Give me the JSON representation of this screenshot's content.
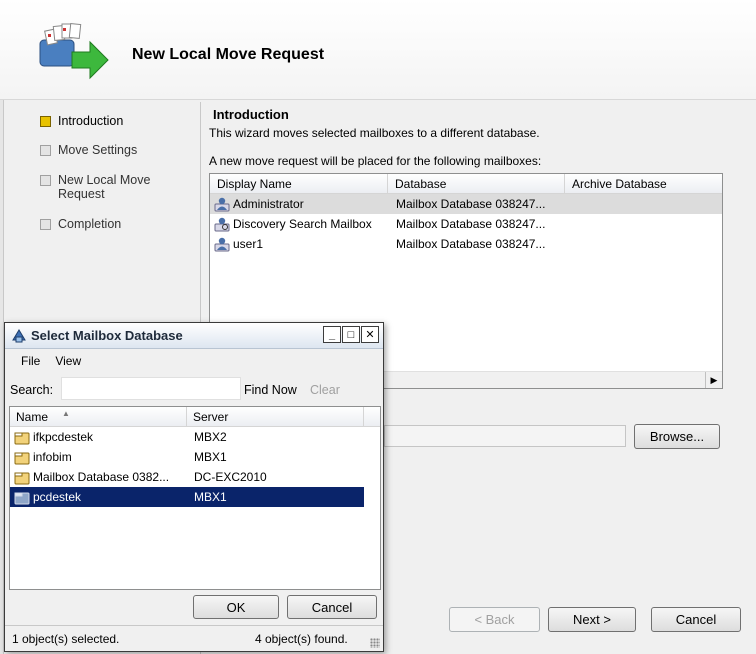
{
  "wizard": {
    "title": "New Local Move Request",
    "steps": [
      {
        "label": "Introduction",
        "active": true
      },
      {
        "label": "Move Settings",
        "active": false
      },
      {
        "label": "New Local Move Request",
        "active": false
      },
      {
        "label": "Completion",
        "active": false
      }
    ],
    "intro_title": "Introduction",
    "intro_desc": "This wizard moves selected mailboxes to a different database.",
    "list_caption": "A new move request will be placed for the following mailboxes:",
    "columns": [
      "Display Name",
      "Database",
      "Archive Database"
    ],
    "rows": [
      {
        "name": "Administrator",
        "database": "Mailbox Database 038247...",
        "archive": "",
        "selected": true
      },
      {
        "name": "Discovery Search Mailbox",
        "database": "Mailbox Database 038247...",
        "archive": "",
        "selected": false
      },
      {
        "name": "user1",
        "database": "Mailbox Database 038247...",
        "archive": "",
        "selected": false
      }
    ],
    "browse_label": "Browse...",
    "back_label": "< Back",
    "next_label": "Next >",
    "cancel_label": "Cancel"
  },
  "dialog": {
    "title": "Select Mailbox Database",
    "menu": [
      "File",
      "View"
    ],
    "search_label": "Search:",
    "search_value": "",
    "find_now_label": "Find Now",
    "clear_label": "Clear",
    "columns": [
      "Name",
      "Server"
    ],
    "rows": [
      {
        "name": "ifkpcdestek",
        "server": "MBX2",
        "selected": false
      },
      {
        "name": "infobim",
        "server": "MBX1",
        "selected": false
      },
      {
        "name": "Mailbox Database 0382...",
        "server": "DC-EXC2010",
        "selected": false
      },
      {
        "name": "pcdestek",
        "server": "MBX1",
        "selected": true
      }
    ],
    "ok_label": "OK",
    "cancel_label": "Cancel",
    "status_selected": "1 object(s) selected.",
    "status_found": "4 object(s) found."
  },
  "colors": {
    "selection_blue": "#0a246a",
    "active_step": "#e8c200"
  }
}
